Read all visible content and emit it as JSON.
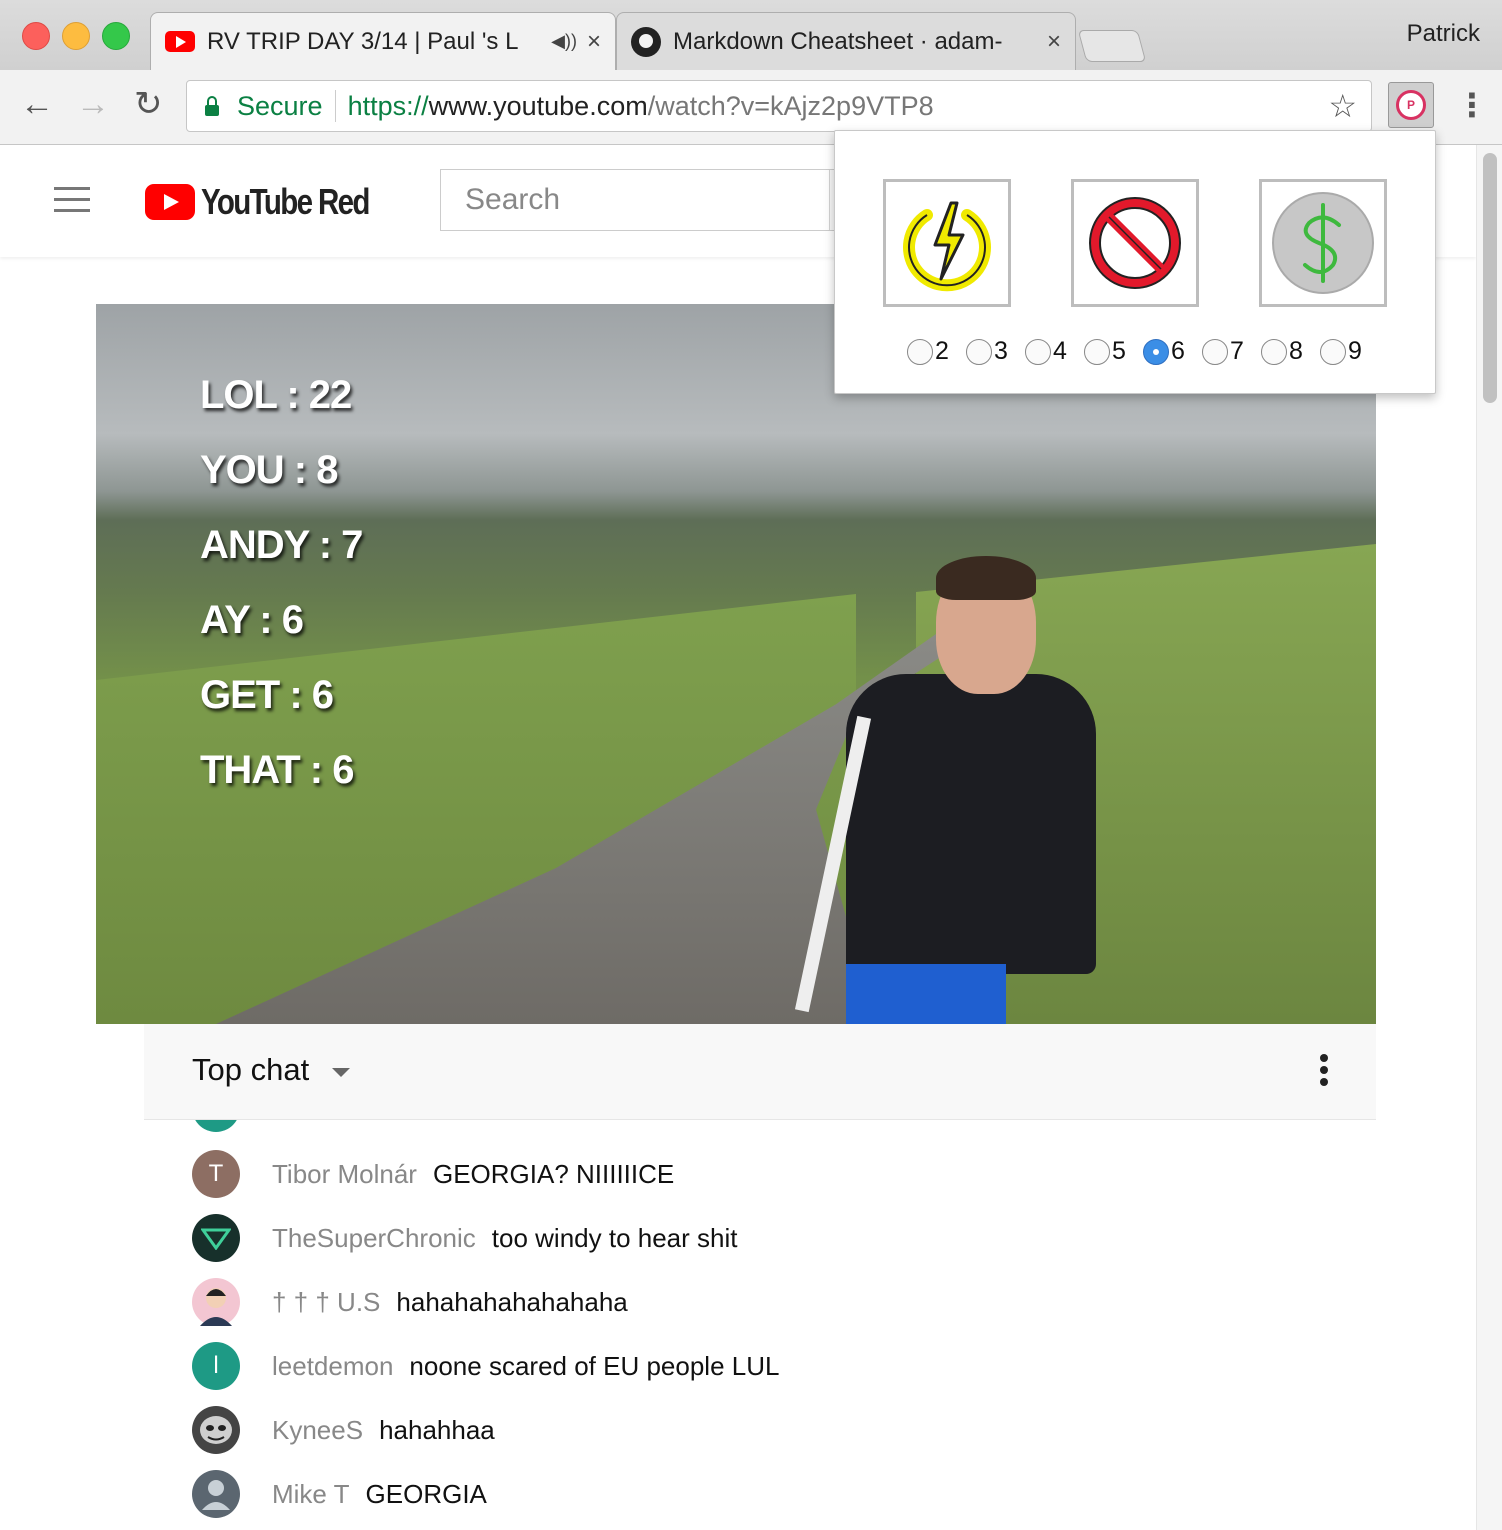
{
  "browser": {
    "tabs": [
      {
        "title": "RV TRIP DAY 3/14 | Paul 's L",
        "icon": "youtube-icon",
        "audio": "speaker-icon",
        "close": "×"
      },
      {
        "title": "Markdown Cheatsheet · adam-",
        "icon": "github-icon",
        "close": "×"
      }
    ],
    "profile_name": "Patrick",
    "nav": {
      "back": "←",
      "forward": "→",
      "reload": "↻"
    },
    "omnibox": {
      "secure_label": "Secure",
      "url_scheme": "https://",
      "url_host": "www.youtube.com",
      "url_path": "/watch?v=kAjz2p9VTP8"
    },
    "star": "☆",
    "menu": "⋮",
    "extension_icon": "P"
  },
  "youtube": {
    "logo_text": "YouTube Red",
    "search_placeholder": "Search"
  },
  "video_overlay": {
    "stats": [
      "LOL : 22",
      "YOU : 8",
      "ANDY : 7",
      "AY : 6",
      "GET : 6",
      "THAT : 6"
    ]
  },
  "chat": {
    "title": "Top chat",
    "messages": [
      {
        "author": "Tibor Molnár",
        "text": "GEORGIA? NIIIIIICE",
        "avatar_letter": "T",
        "avatar_color": "#8d6e63"
      },
      {
        "author": "TheSuperChronic",
        "text": "too windy to hear shit",
        "avatar_letter": "",
        "avatar_color": "#17302b"
      },
      {
        "author": "† † † U.S",
        "text": "hahahahahahahaha",
        "avatar_letter": "",
        "avatar_color": "#f3c6d2"
      },
      {
        "author": "leetdemon",
        "text": "noone scared of EU people LUL",
        "avatar_letter": "l",
        "avatar_color": "#1e9a85"
      },
      {
        "author": "KyneeS",
        "text": "hahahhaa",
        "avatar_letter": "",
        "avatar_color": "#444444"
      },
      {
        "author": "Mike T",
        "text": "GEORGIA",
        "avatar_letter": "",
        "avatar_color": "#5b6670"
      }
    ]
  },
  "extension_popup": {
    "tiles": [
      {
        "icon": "power-lightning-icon"
      },
      {
        "icon": "prohibited-icon"
      },
      {
        "icon": "dollar-coin-icon"
      }
    ],
    "options": [
      "2",
      "3",
      "4",
      "5",
      "6",
      "7",
      "8",
      "9"
    ],
    "selected": "6"
  }
}
